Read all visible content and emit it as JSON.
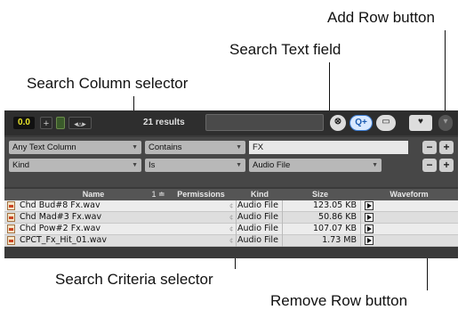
{
  "callouts": {
    "add_row": "Add Row button",
    "search_text": "Search Text field",
    "search_column": "Search Column selector",
    "search_criteria": "Search Criteria selector",
    "remove_row": "Remove Row button"
  },
  "toolbar": {
    "counter": "0.0",
    "results": "21 results",
    "search_value": ""
  },
  "criteria": [
    {
      "column": "Any Text Column",
      "condition": "Contains",
      "value": "FX"
    },
    {
      "column": "Kind",
      "condition": "Is",
      "value": "Audio File"
    }
  ],
  "table": {
    "headers": {
      "name": "Name",
      "sort": "1",
      "permissions": "Permissions",
      "kind": "Kind",
      "size": "Size",
      "waveform": "Waveform"
    },
    "rows": [
      {
        "name": "Chd Bud#8 Fx.wav",
        "kind": "Audio File",
        "size": "123.05 KB"
      },
      {
        "name": "Chd Mad#3 Fx.wav",
        "kind": "Audio File",
        "size": "50.86 KB"
      },
      {
        "name": "Chd Pow#2 Fx.wav",
        "kind": "Audio File",
        "size": "107.07 KB"
      },
      {
        "name": "CPCT_Fx_Hit_01.wav",
        "kind": "Audio File",
        "size": "1.73 MB"
      }
    ]
  },
  "icons": [
    "file-audio-icon",
    "play-icon",
    "heart-icon",
    "add-icon",
    "remove-icon",
    "clear-icon",
    "search-add-icon"
  ],
  "colors": {
    "counter_text": "#e8e42a",
    "panel_bg": "#3a3a3a",
    "row_bg": "#ececec"
  }
}
